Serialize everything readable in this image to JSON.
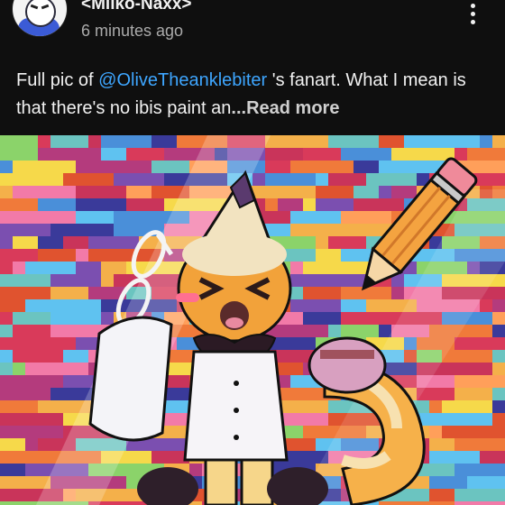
{
  "post": {
    "username": "<Miiko-Naxx>",
    "timestamp": "6 minutes ago",
    "text_before": "Full pic of ",
    "mention": "@OliveTheanklebiter",
    "text_after": " 's fanart. What I mean is that there's no ibis paint an",
    "read_more": "...Read more"
  },
  "colors": {
    "background": "#0f0f0f",
    "mention": "#3ea6ff",
    "secondary_text": "#aaaaaa"
  },
  "icons": {
    "more": "vertical-dots-icon",
    "avatar": "profile-avatar"
  }
}
